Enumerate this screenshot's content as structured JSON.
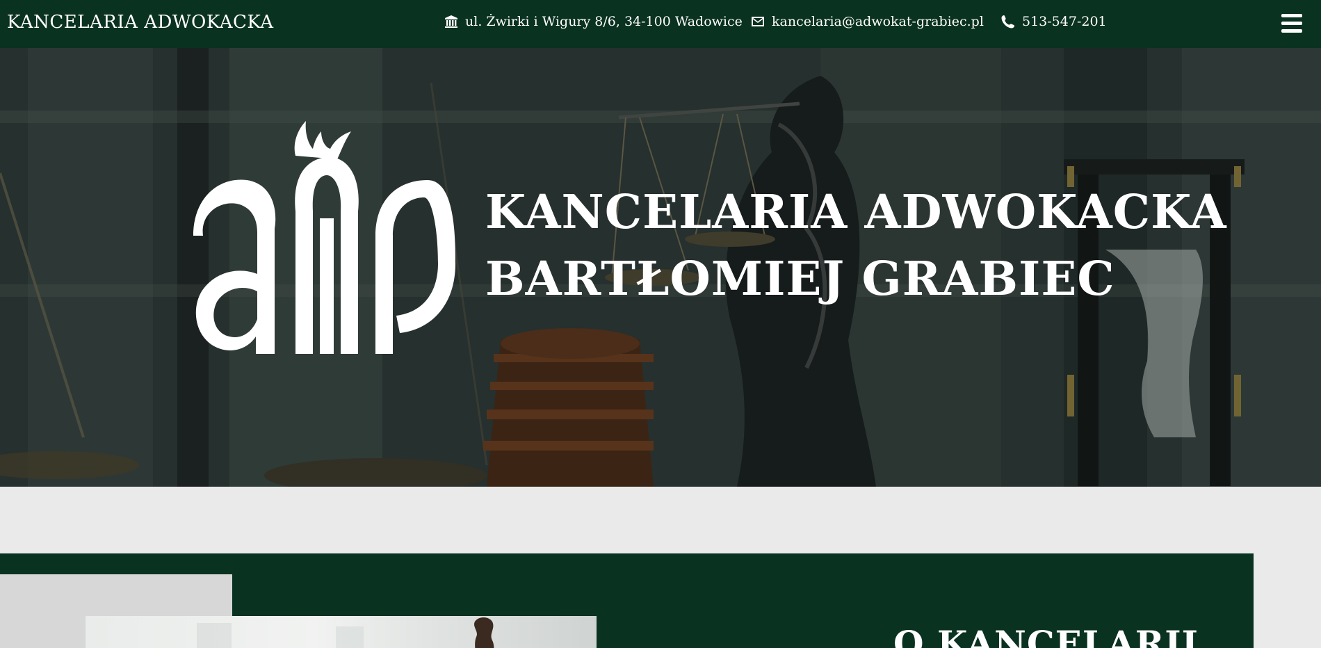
{
  "header": {
    "brand": "KANCELARIA ADWOKACKA",
    "address": "ul. Żwirki i Wigury 8/6, 34-100 Wadowice",
    "email": "kancelaria@adwokat-grabiec.pl",
    "phone": "513-547-201",
    "icons": [
      "building-icon",
      "envelope-icon",
      "phone-icon",
      "menu-icon"
    ]
  },
  "hero": {
    "title_line1": "KANCELARIA ADWOKACKA",
    "title_line2": "BARTŁOMIEJ GRABIEC"
  },
  "about": {
    "title": "O KANCELARII"
  },
  "colors": {
    "primary_green": "#0a3220",
    "background": "#eaeaea",
    "text_light": "#ffffff"
  }
}
